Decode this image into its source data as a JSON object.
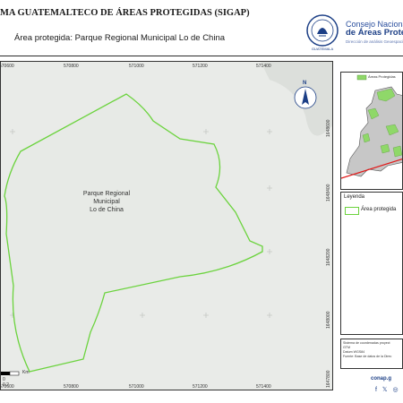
{
  "header": {
    "title": "MA GUATEMALTECO DE ÁREAS PROTEGIDAS (SIGAP)",
    "subtitle": "Área protegida: Parque Regional Municipal Lo de China"
  },
  "logo": {
    "seal_text": "CONSEJO NACIONAL DE ÁREAS PROTEGIDAS · GUATEMALA",
    "line1": "Consejo Nacional",
    "line2": "de Áreas Protegi",
    "line3": "Dirección de análisis Geoespacial"
  },
  "map": {
    "area_label": [
      "Parque Regional",
      "Municipal",
      "Lo de China"
    ],
    "x_ticks": [
      "570600",
      "570800",
      "571000",
      "571200",
      "571400"
    ],
    "y_ticks": [
      "1648600",
      "1648400",
      "1648200",
      "1648000",
      "1647800"
    ],
    "north_label": "N",
    "scale_bar": {
      "zero": "0",
      "mid": "0.2",
      "unit": "Km"
    },
    "colors": {
      "boundary": "#6bd33d",
      "fill": "#eaede8",
      "grid": "#c9ccc8"
    }
  },
  "inset": {
    "legend_label": "Áreas Protegidas",
    "colors": {
      "country": "#c7c7c7",
      "protected": "#8fd869",
      "boundary_line": "#e11818"
    }
  },
  "legend": {
    "title": "Leyenda",
    "item": "Área protegida"
  },
  "notes": {
    "line1": "Sistema de coordenadas proyect",
    "line2": "GTM",
    "line3": "Datum WGS84",
    "line4": "Fuente: Base de datos de la Direc"
  },
  "footer": {
    "site": "conap.g",
    "social": "f 𝕏 ◎"
  }
}
